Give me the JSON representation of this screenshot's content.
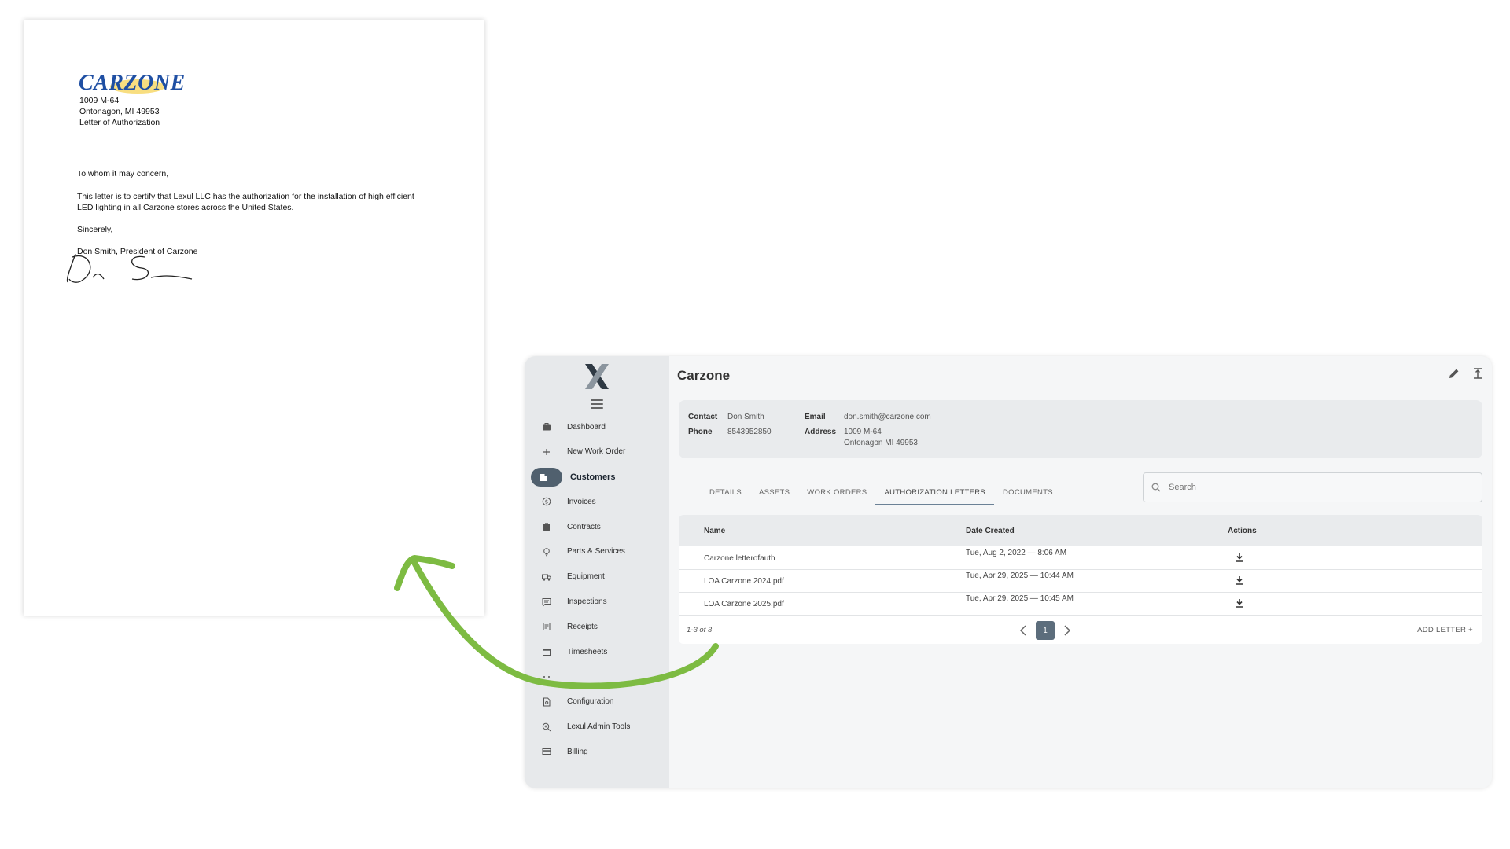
{
  "letter": {
    "logo": "CARZONE",
    "address_line1": "1009 M-64",
    "address_line2": "Ontonagon, MI 49953",
    "doc_type": "Letter of Authorization",
    "greeting": "To whom it may concern,",
    "body_line1": "This letter is to certify that Lexul LLC has the authorization for the installation of high efficient",
    "body_line2": "LED lighting in all Carzone stores across the United States.",
    "closing": "Sincerely,",
    "signer": "Don Smith, President of Carzone"
  },
  "sidebar": {
    "items": [
      {
        "label": "Dashboard",
        "icon": "briefcase-icon"
      },
      {
        "label": "New Work Order",
        "icon": "plus-icon"
      },
      {
        "label": "Customers",
        "icon": "building-icon"
      },
      {
        "label": "Invoices",
        "icon": "dollar-circle-icon"
      },
      {
        "label": "Contracts",
        "icon": "clipboard-icon"
      },
      {
        "label": "Parts & Services",
        "icon": "lightbulb-icon"
      },
      {
        "label": "Equipment",
        "icon": "truck-icon"
      },
      {
        "label": "Inspections",
        "icon": "comment-icon"
      },
      {
        "label": "Receipts",
        "icon": "receipt-icon"
      },
      {
        "label": "Timesheets",
        "icon": "calendar-icon"
      },
      {
        "label": "",
        "icon": "more-icon"
      },
      {
        "label": "Configuration",
        "icon": "file-gear-icon"
      },
      {
        "label": "Lexul Admin Tools",
        "icon": "zoom-icon"
      },
      {
        "label": "Billing",
        "icon": "credit-card-icon"
      }
    ]
  },
  "customer": {
    "name": "Carzone",
    "contact_label": "Contact",
    "contact": "Don Smith",
    "phone_label": "Phone",
    "phone": "8543952850",
    "email_label": "Email",
    "email": "don.smith@carzone.com",
    "address_label": "Address",
    "address_line1": "1009 M-64",
    "address_line2": "Ontonagon  MI 49953"
  },
  "tabs": [
    "DETAILS",
    "ASSETS",
    "WORK ORDERS",
    "AUTHORIZATION LETTERS",
    "DOCUMENTS"
  ],
  "search": {
    "placeholder": "Search"
  },
  "table": {
    "columns": [
      "Name",
      "Date Created",
      "Actions"
    ],
    "rows": [
      {
        "name": "Carzone letterofauth",
        "date": "Tue, Aug 2, 2022 — 8:06 AM"
      },
      {
        "name": "LOA Carzone 2024.pdf",
        "date": "Tue, Apr 29, 2025 — 10:44 AM"
      },
      {
        "name": "LOA Carzone 2025.pdf",
        "date": "Tue, Apr 29, 2025 — 10:45 AM"
      }
    ]
  },
  "pagination": {
    "count": "1-3 of 3",
    "page": "1"
  },
  "add_letter": "ADD LETTER +",
  "colors": {
    "accent": "#50606e",
    "arrow": "#7dbb42",
    "logo_blue": "#1f4fa3"
  }
}
